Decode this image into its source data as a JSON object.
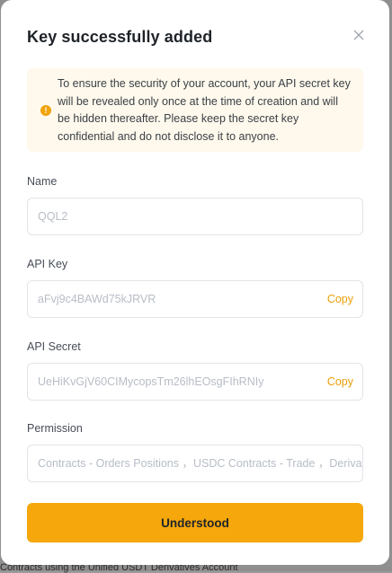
{
  "modal": {
    "title": "Key successfully added",
    "notice": "To ensure the security of your account, your API secret key will be revealed only once at the time of creation and will be hidden thereafter. Please keep the secret key confidential and do not disclose it to anyone.",
    "notice_icon": "exclamation-icon",
    "close_icon": "close-icon"
  },
  "fields": {
    "name": {
      "label": "Name",
      "value": "QQL2"
    },
    "api_key": {
      "label": "API Key",
      "value": "aFvj9c4BAWd75kJRVR",
      "action": "Copy"
    },
    "api_secret": {
      "label": "API Secret",
      "value": "UeHiKvGjV60CIMycopsTm26lhEOsgFIhRNIy",
      "action": "Copy"
    },
    "permission": {
      "label": "Permission",
      "value": "Contracts - Orders Positions ，USDC Contracts - Trade ，Derivatives"
    }
  },
  "confirm_button": "Understood",
  "background": {
    "text": "Contracts using the Unified USDT Derivatives Account"
  },
  "colors": {
    "accent": "#f5a70b",
    "copy": "#e8a008",
    "notice_bg": "#fef9ec"
  }
}
